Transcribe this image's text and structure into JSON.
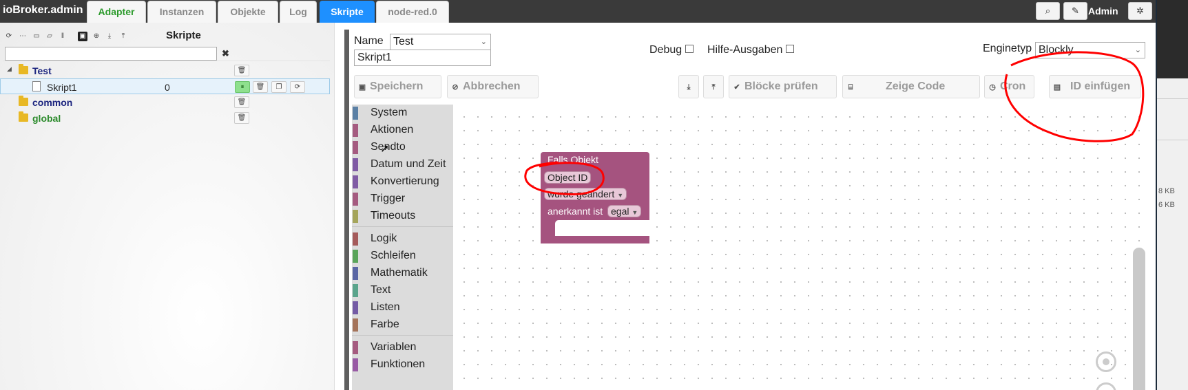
{
  "app": {
    "brand": "ioBroker.admin",
    "user": "Admin"
  },
  "tabs": [
    {
      "label": "Adapter"
    },
    {
      "label": "Instanzen"
    },
    {
      "label": "Objekte"
    },
    {
      "label": "Log"
    },
    {
      "label": "Skripte"
    },
    {
      "label": "node-red.0"
    }
  ],
  "right_window": {
    "size1": "8 KB",
    "size2": "6 KB"
  },
  "left_panel": {
    "title": "Skripte",
    "search_value": "",
    "clear_glyph": "✖",
    "tree": [
      {
        "label": "Test",
        "kind": "folder",
        "color": "navy",
        "expand": "◢"
      },
      {
        "label": "Skript1",
        "kind": "script",
        "value": "0"
      },
      {
        "label": "common",
        "kind": "folder",
        "color": "navy"
      },
      {
        "label": "global",
        "kind": "folder",
        "color": "green"
      }
    ]
  },
  "editor": {
    "name_label": "Name",
    "name_value": "Test",
    "script_name": "Skript1",
    "debug_label": "Debug",
    "help_label": "Hilfe-Ausgaben",
    "engine_label": "Enginetyp",
    "engine_value": "Blockly",
    "buttons": {
      "save": "Speichern",
      "cancel": "Abbrechen",
      "check": "Blöcke prüfen",
      "code": "Zeige Code",
      "cron": "Cron",
      "insert_id": "ID einfügen"
    }
  },
  "toolbox": {
    "categories": [
      {
        "label": "System",
        "color": "#5b80a5"
      },
      {
        "label": "Aktionen",
        "color": "#a55b80"
      },
      {
        "label": "Sendto",
        "color": "#a55b80"
      },
      {
        "label": "Datum und Zeit",
        "color": "#805ba5"
      },
      {
        "label": "Konvertierung",
        "color": "#805ba5"
      },
      {
        "label": "Trigger",
        "color": "#a55b80"
      },
      {
        "label": "Timeouts",
        "color": "#a5a55b"
      },
      {
        "label": "Logik",
        "color": "#a55b5b"
      },
      {
        "label": "Schleifen",
        "color": "#5ba55b"
      },
      {
        "label": "Mathematik",
        "color": "#5b67a5"
      },
      {
        "label": "Text",
        "color": "#5ba58c"
      },
      {
        "label": "Listen",
        "color": "#745ba5"
      },
      {
        "label": "Farbe",
        "color": "#a5745b"
      },
      {
        "label": "Variablen",
        "color": "#a55b80"
      },
      {
        "label": "Funktionen",
        "color": "#995ba5"
      }
    ]
  },
  "block": {
    "title": "Falls Objekt",
    "object_id": "Object ID",
    "changed": "wurde geändert",
    "ack_label": "anerkannt ist",
    "ack_value": "egal",
    "color": "#a5537f"
  },
  "annotation": {
    "color": "#ff0000"
  }
}
